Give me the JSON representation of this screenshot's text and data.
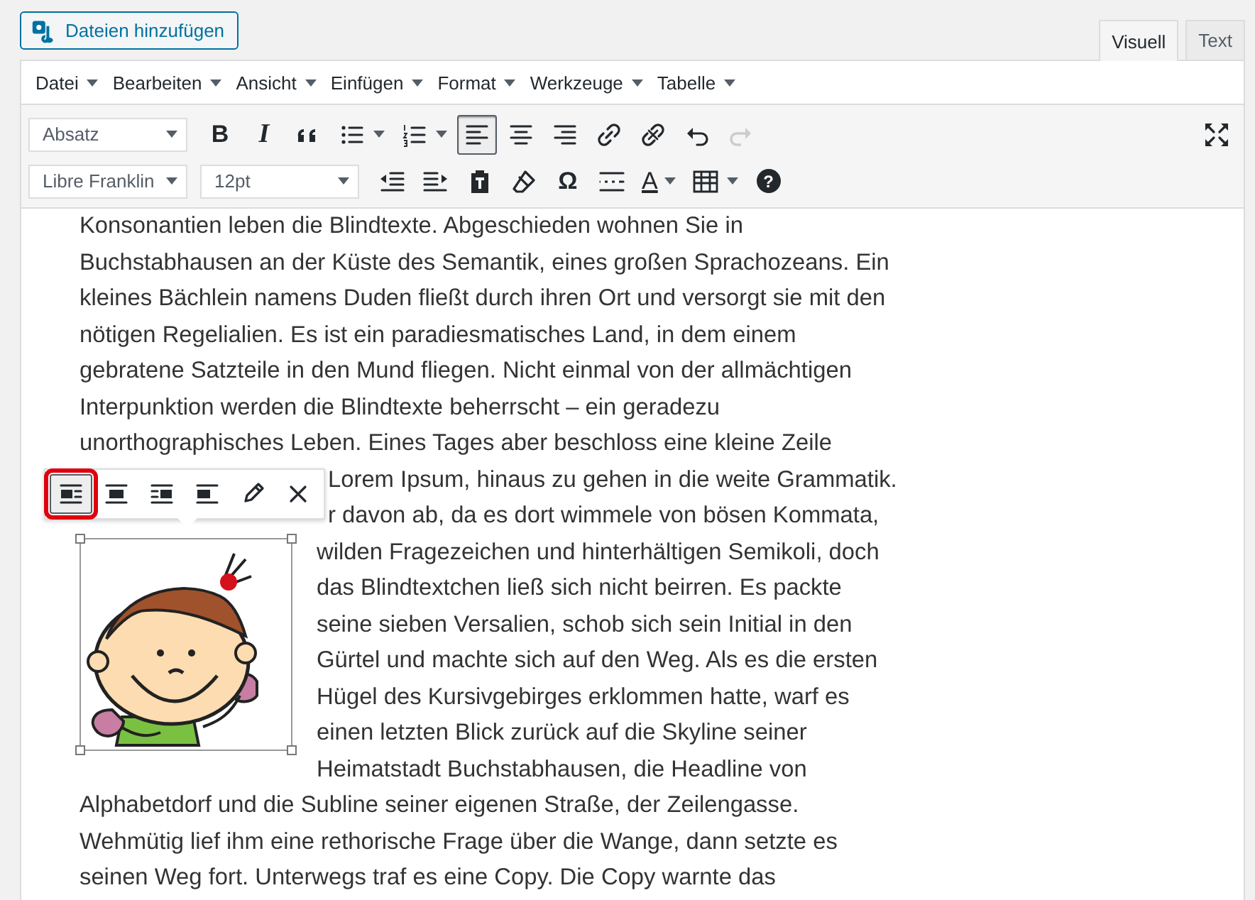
{
  "add_media_button": {
    "label": "Dateien hinzufügen"
  },
  "editor_tabs": [
    {
      "label": "Visuell",
      "selected": true
    },
    {
      "label": "Text",
      "selected": false
    }
  ],
  "menu": [
    "Datei",
    "Bearbeiten",
    "Ansicht",
    "Einfügen",
    "Format",
    "Werkzeuge",
    "Tabelle"
  ],
  "toolbar_rows": [
    [
      {
        "kind": "select",
        "value": "Absatz"
      },
      {
        "kind": "bold",
        "text": "B",
        "selected": false,
        "disabled": false
      },
      {
        "kind": "italic",
        "text": "I",
        "selected": false,
        "disabled": false
      },
      {
        "kind": "quote",
        "selected": false,
        "disabled": false
      },
      {
        "kind": "bullist",
        "selected": false,
        "disabled": false,
        "caret": true
      },
      {
        "kind": "numlist",
        "selected": false,
        "disabled": false,
        "caret": true
      },
      {
        "kind": "alignleft",
        "selected": true,
        "disabled": false
      },
      {
        "kind": "aligncenter",
        "selected": false,
        "disabled": false
      },
      {
        "kind": "alignright",
        "selected": false,
        "disabled": false
      },
      {
        "kind": "link",
        "selected": false,
        "disabled": false
      },
      {
        "kind": "unlink",
        "selected": false,
        "disabled": false
      },
      {
        "kind": "undo",
        "selected": false,
        "disabled": false
      },
      {
        "kind": "redo",
        "selected": false,
        "disabled": true
      },
      {
        "kind": "fullscreen",
        "selected": false,
        "disabled": false
      }
    ],
    [
      {
        "kind": "select",
        "value": "Libre Franklin"
      },
      {
        "kind": "select",
        "value": "12pt"
      },
      {
        "kind": "outdent",
        "selected": false,
        "disabled": false
      },
      {
        "kind": "indent",
        "selected": false,
        "disabled": false
      },
      {
        "kind": "pastetext",
        "selected": false,
        "disabled": false
      },
      {
        "kind": "eraser",
        "selected": false,
        "disabled": false
      },
      {
        "kind": "charmap",
        "text": "Ω",
        "selected": false,
        "disabled": false
      },
      {
        "kind": "hr",
        "selected": false,
        "disabled": false
      },
      {
        "kind": "textcolor",
        "text": "A",
        "selected": false,
        "disabled": false,
        "caret": true
      },
      {
        "kind": "table",
        "selected": false,
        "disabled": false,
        "caret": true
      },
      {
        "kind": "help",
        "text": "?",
        "selected": false,
        "disabled": false
      }
    ]
  ],
  "content": {
    "lines_before": [
      "Konsonantien leben die Blindtexte. Abgeschieden wohnen Sie in",
      "Buchstabhausen an der Küste des Semantik, eines großen Sprachozeans. Ein",
      "kleines Bächlein namens Duden fließt durch ihren Ort und versorgt sie mit den",
      "nötigen Regelialien. Es ist ein paradiesmatisches Land, in dem einem",
      "gebratene Satzteile in den Mund fliegen. Nicht einmal von der allmächtigen",
      "Interpunktion werden die Blindtexte beherrscht – ein geradezu",
      "unorthographisches Leben. Eines Tages aber beschloss eine kleine Zeile"
    ],
    "lines_beside_toolbar": [
      "Lorem Ipsum, hinaus zu gehen in die weite Grammatik.",
      "r davon ab, da es dort wimmele von bösen Kommata,"
    ],
    "image_toolbar": [
      {
        "kind": "alignleft",
        "selected": true
      },
      {
        "kind": "aligncenter",
        "selected": false
      },
      {
        "kind": "alignright",
        "selected": false
      },
      {
        "kind": "alignnone",
        "selected": false
      },
      {
        "kind": "edit",
        "selected": false
      },
      {
        "kind": "remove",
        "selected": false
      }
    ],
    "lines_beside_image": [
      "wilden Fragezeichen und hinterhältigen Semikoli, doch",
      "das Blindtextchen ließ sich nicht beirren. Es packte",
      "seine sieben Versalien, schob sich sein Initial in den",
      "Gürtel und machte sich auf den Weg. Als es die ersten",
      "Hügel des Kursivgebirges erklommen hatte, warf es",
      "einen letzten Blick zurück auf die Skyline seiner",
      "Heimatstadt Buchstabhausen, die Headline von"
    ],
    "lines_after": [
      "Alphabetdorf und die Subline seiner eigenen Straße, der Zeilengasse.",
      "Wehmütig lief ihm eine rethorische Frage über die Wange, dann setzte es",
      "seinen Weg fort. Unterwegs traf es eine Copy. Die Copy warnte das"
    ]
  }
}
